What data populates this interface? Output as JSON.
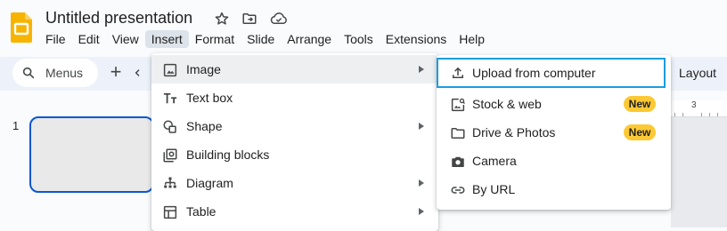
{
  "app": {
    "logo_icon": "slides-logo-icon",
    "brand_color": "#f6b400",
    "title": "Untitled presentation",
    "title_icons": [
      "star-icon",
      "move-to-folder-icon",
      "cloud-status-icon"
    ]
  },
  "menubar": {
    "items": [
      {
        "label": "File"
      },
      {
        "label": "Edit"
      },
      {
        "label": "View"
      },
      {
        "label": "Insert",
        "active": true
      },
      {
        "label": "Format"
      },
      {
        "label": "Slide"
      },
      {
        "label": "Arrange"
      },
      {
        "label": "Tools"
      },
      {
        "label": "Extensions"
      },
      {
        "label": "Help"
      }
    ]
  },
  "toolbar": {
    "search_label": "Menus",
    "search_icon": "search-icon",
    "plus_label": "+",
    "layout_label": "Layout"
  },
  "ruler": {
    "number": "3"
  },
  "filmstrip": {
    "slide_number": "1"
  },
  "insert_menu": {
    "items": [
      {
        "label": "Image",
        "icon": "image-icon",
        "has_submenu": true,
        "highlighted": true
      },
      {
        "label": "Text box",
        "icon": "text-box-icon",
        "has_submenu": false
      },
      {
        "label": "Shape",
        "icon": "shape-icon",
        "has_submenu": true
      },
      {
        "label": "Building blocks",
        "icon": "building-blocks-icon",
        "has_submenu": false
      },
      {
        "label": "Diagram",
        "icon": "diagram-icon",
        "has_submenu": true
      },
      {
        "label": "Table",
        "icon": "table-icon",
        "has_submenu": true
      }
    ]
  },
  "image_submenu": {
    "items": [
      {
        "label": "Upload from computer",
        "icon": "upload-icon",
        "focused": true
      },
      {
        "label": "Stock & web",
        "icon": "stock-image-icon",
        "badge": "New"
      },
      {
        "label": "Drive & Photos",
        "icon": "folder-icon",
        "badge": "New"
      },
      {
        "label": "Camera",
        "icon": "camera-icon"
      },
      {
        "label": "By URL",
        "icon": "link-icon"
      }
    ],
    "focus_color": "#1a9de0",
    "badge_color": "#fcc934"
  }
}
